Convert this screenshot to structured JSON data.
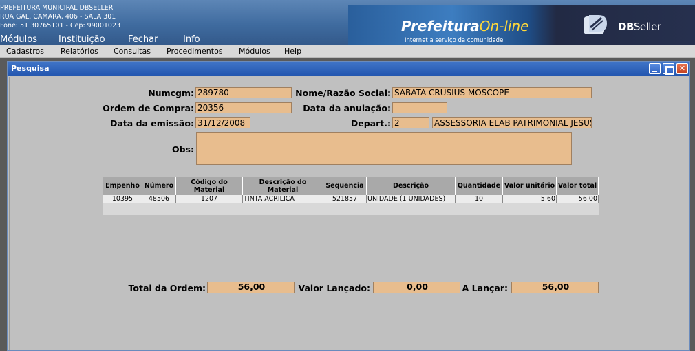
{
  "header": {
    "org_line1": "PREFEITURA MUNICIPAL DBSELLER",
    "org_line2": "RUA GAL. CAMARA, 406 - SALA 301",
    "org_line3": "Fone: 51 30765101  -  Cep: 99001023",
    "nav": [
      "Módulos",
      "Instituição",
      "Fechar",
      "Info"
    ],
    "banner_prefeitura": "Prefeitura",
    "banner_online": "On-line",
    "banner_tagline": "Internet a serviço da comunidade",
    "brand_db": "DB",
    "brand_seller": "Seller"
  },
  "menubar": [
    "Cadastros",
    "Relatórios",
    "Consultas",
    "Procedimentos",
    "Módulos",
    "Help"
  ],
  "window": {
    "title": "Pesquisa"
  },
  "form": {
    "numcgm_label": "Numcgm:",
    "numcgm": "289780",
    "nome_label": "Nome/Razão Social:",
    "nome": "SABATA CRUSIUS MOSCOPE",
    "ordem_label": "Ordem de Compra:",
    "ordem": "20356",
    "anulacao_label": "Data da anulação:",
    "anulacao": "",
    "emissao_label": "Data da emissão:",
    "emissao": "31/12/2008",
    "depart_label": "Depart.:",
    "depart_code": "2",
    "depart_name": "ASSESSORIA ELAB PATRIMONIAL JESUS",
    "obs_label": "Obs:",
    "obs": ""
  },
  "table": {
    "headers": [
      "Empenho",
      "Número",
      "Código do Material",
      "Descrição do Material",
      "Sequencia",
      "Descrição",
      "Quantidade",
      "Valor unitário",
      "Valor total"
    ],
    "rows": [
      [
        "10395",
        "48506",
        "1207",
        "TINTA ACRILICA",
        "521857",
        "UNIDADE (1 UNIDADES)",
        "10",
        "5,60",
        "56,00"
      ]
    ]
  },
  "totals": {
    "total_label": "Total da Ordem:",
    "total": "56,00",
    "lancado_label": "Valor Lançado:",
    "lancado": "0,00",
    "alancar_label": "A Lançar:",
    "alancar": "56,00"
  }
}
